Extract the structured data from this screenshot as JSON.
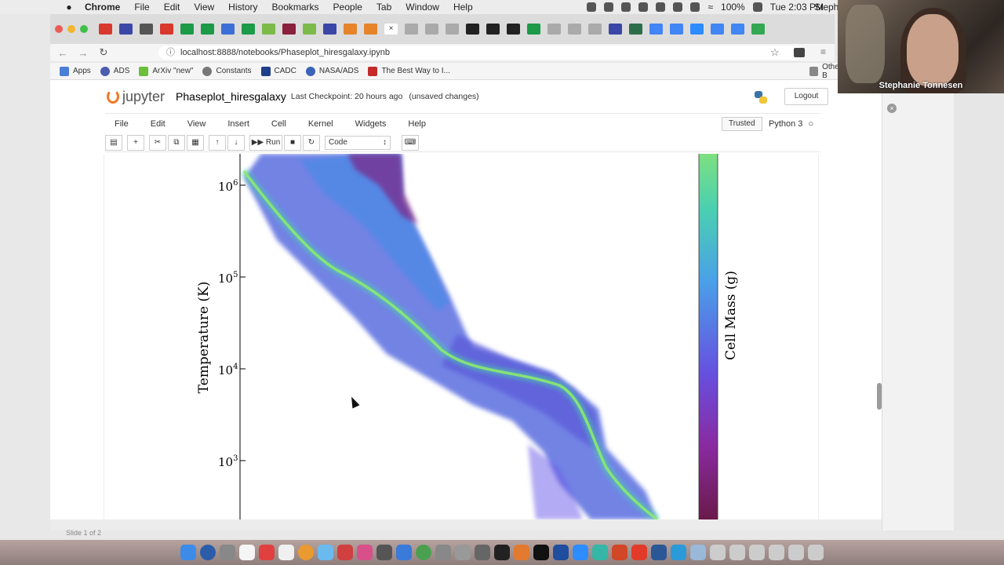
{
  "menubar": {
    "apple": "",
    "app_name": "Chrome",
    "items": [
      "File",
      "Edit",
      "View",
      "History",
      "Bookmarks",
      "People",
      "Tab",
      "Window",
      "Help"
    ],
    "battery": "100%",
    "clock": "Tue 2:03 PM",
    "user_partial": "Steph"
  },
  "browser": {
    "url": "localhost:8888/notebooks/Phaseplot_hiresgalaxy.ipynb",
    "bookmarks": [
      {
        "label": "Apps",
        "color": "#4a7fd6"
      },
      {
        "label": "ADS",
        "color": "#4b5bb0"
      },
      {
        "label": "ArXiv \"new\"",
        "color": "#6bbf3b"
      },
      {
        "label": "Constants",
        "color": "#777777"
      },
      {
        "label": "CADC",
        "color": "#1e3f8a"
      },
      {
        "label": "NASA/ADS",
        "color": "#3b63b8"
      },
      {
        "label": "The Best Way to I...",
        "color": "#c52a2a"
      }
    ],
    "other_bookmarks": "Other B"
  },
  "webcam": {
    "name": "Stephanie Tonnesen"
  },
  "jupyter": {
    "logo_text": "jupyter",
    "notebook_name": "Phaseplot_hiresgalaxy",
    "checkpoint": "Last Checkpoint: 20 hours ago",
    "unsaved": "(unsaved changes)",
    "logout": "Logout",
    "menu": [
      "File",
      "Edit",
      "View",
      "Insert",
      "Cell",
      "Kernel",
      "Widgets",
      "Help"
    ],
    "trusted": "Trusted",
    "kernel": "Python 3",
    "toolbar": {
      "run_label": "Run",
      "cell_type": "Code"
    }
  },
  "plot": {
    "ylabel": "Temperature (K)",
    "colorbar_label": "Cell Mass (g)",
    "yticks": [
      {
        "base": "10",
        "exp": "6"
      },
      {
        "base": "10",
        "exp": "5"
      },
      {
        "base": "10",
        "exp": "4"
      },
      {
        "base": "10",
        "exp": "3"
      }
    ]
  },
  "status": {
    "slide": "Slide 1 of 2"
  }
}
